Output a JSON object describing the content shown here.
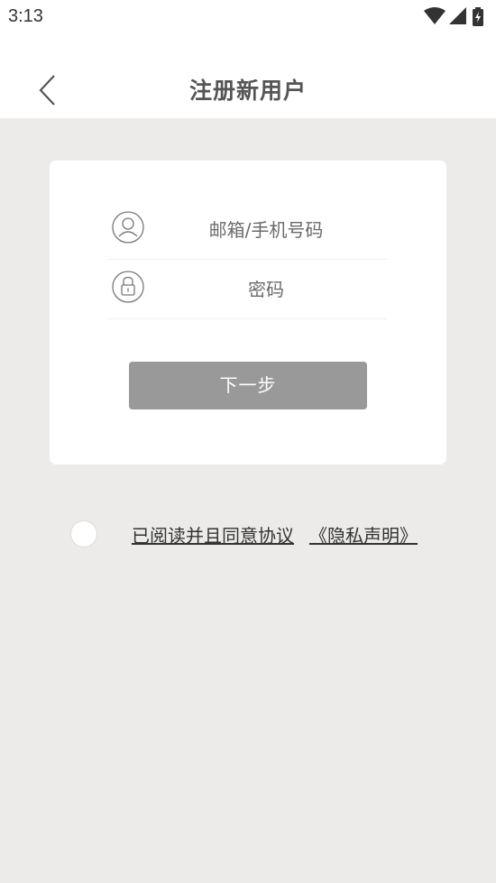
{
  "status_bar": {
    "time": "3:13",
    "icons": [
      "wifi-icon",
      "cellular-signal-icon",
      "battery-charging-icon"
    ]
  },
  "header": {
    "title": "注册新用户",
    "back_icon": "chevron-left-icon"
  },
  "form": {
    "email_placeholder": "邮箱/手机号码",
    "email_value": "",
    "email_icon": "user-icon",
    "password_placeholder": "密码",
    "password_value": "",
    "password_icon": "lock-icon",
    "next_label": "下一步"
  },
  "agreement": {
    "checked": false,
    "text": "已阅读并且同意协议",
    "link_text": "《隐私声明》"
  },
  "colors": {
    "page_background": "#ecebea",
    "surface": "#ffffff",
    "button_disabled": "#999999",
    "title_text": "#555555"
  }
}
